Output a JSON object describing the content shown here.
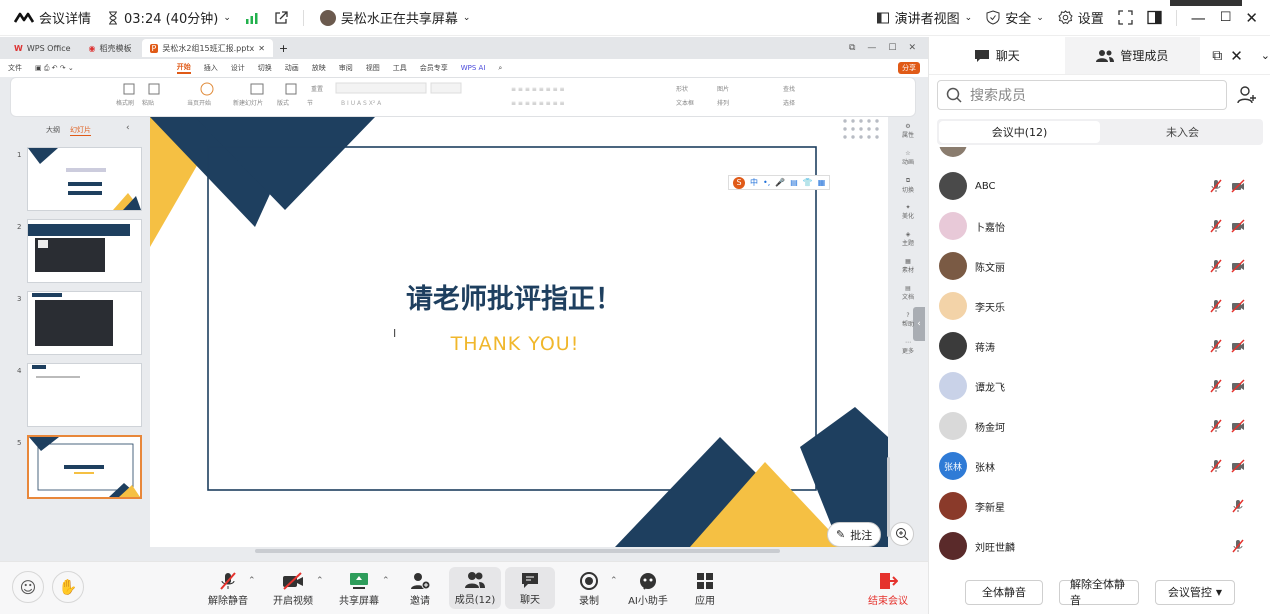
{
  "topbar": {
    "meeting_details": "会议详情",
    "timer": "03:24 (40分钟)",
    "sharer_status": "吴松水正在共享屏幕",
    "presenter_view": "演讲者视图",
    "security": "安全",
    "settings": "设置"
  },
  "wps": {
    "tabs": [
      "WPS Office",
      "稻壳模板",
      "吴松水2组15班汇报.pptx"
    ],
    "menu": [
      "文件",
      "开始",
      "插入",
      "设计",
      "切换",
      "动画",
      "放映",
      "审阅",
      "视图",
      "工具",
      "会员专享",
      "WPS AI"
    ],
    "active_menu": "开始",
    "share_label": "分享",
    "ribbon": {
      "format_painter": "格式刷",
      "paste": "粘贴",
      "current_start": "当页开始",
      "new_slide": "新建幻灯片",
      "layout": "版式",
      "section": "节",
      "reset": "重置",
      "shape": "形状",
      "picture": "图片",
      "find": "查找",
      "textbox": "文本框",
      "arrange": "排列",
      "select": "选择"
    },
    "outline_tab": "大纲",
    "slides_tab": "幻灯片",
    "thumb_numbers": [
      "1",
      "2",
      "3",
      "4",
      "5"
    ],
    "slide": {
      "title": "请老师批评指正！",
      "subtitle": "THANK YOU!"
    },
    "ime": [
      "中",
      "•,",
      "🎤",
      "▤",
      "👕",
      "▦"
    ],
    "right_tools": [
      "属性",
      "动画",
      "切换",
      "美化",
      "主题",
      "素材",
      "文档",
      "帮助",
      "更多"
    ],
    "annotate": "批注"
  },
  "bottombar": {
    "unmute": "解除静音",
    "start_video": "开启视频",
    "share_screen": "共享屏幕",
    "invite": "邀请",
    "members": "成员(12)",
    "chat": "聊天",
    "record": "录制",
    "ai_assistant": "AI小助手",
    "apps": "应用",
    "end_meeting": "结束会议"
  },
  "panel": {
    "tab_chat": "聊天",
    "tab_manage": "管理成员",
    "search_placeholder": "搜索成员",
    "in_meeting": "会议中(12)",
    "not_joined": "未入会",
    "members": [
      {
        "name": "ABC"
      },
      {
        "name": "卜嘉怡"
      },
      {
        "name": "陈文丽"
      },
      {
        "name": "李天乐"
      },
      {
        "name": "蒋涛"
      },
      {
        "name": "谭龙飞"
      },
      {
        "name": "杨金坷"
      },
      {
        "name": "张林",
        "avatar_text": "张林"
      },
      {
        "name": "李新星"
      },
      {
        "name": "刘旺世麟"
      }
    ],
    "mute_all": "全体静音",
    "unmute_all": "解除全体静音",
    "meeting_control": "会议管控"
  },
  "colors": {
    "navy": "#1e3f5f",
    "yellow": "#f5c043",
    "orange": "#e05a17",
    "end_red": "#e5322d",
    "signal_green": "#22b14c"
  }
}
